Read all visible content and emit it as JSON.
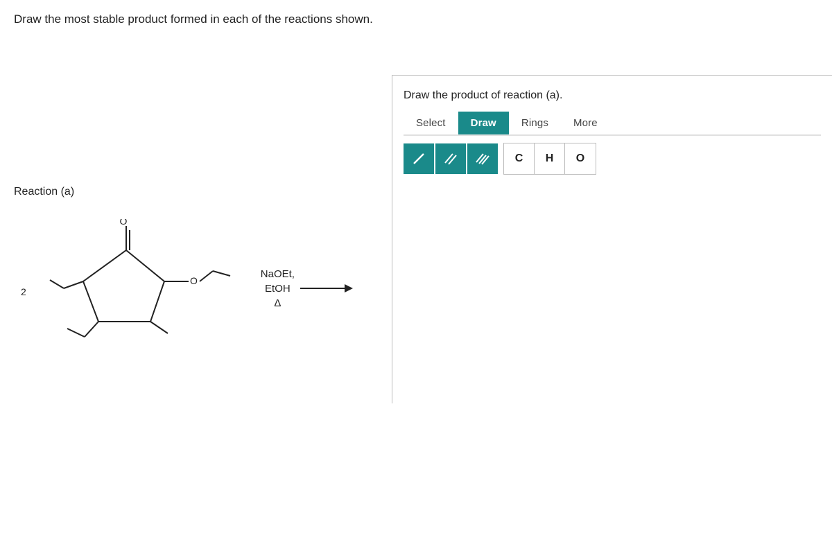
{
  "page": {
    "instruction": "Draw the most stable product formed in each of the reactions shown.",
    "panel_title": "Draw the product of reaction (a).",
    "toolbar": {
      "items": [
        {
          "label": "Select",
          "active": false
        },
        {
          "label": "Draw",
          "active": true
        },
        {
          "label": "Rings",
          "active": false
        },
        {
          "label": "More",
          "active": false
        }
      ]
    },
    "bond_tools": [
      {
        "label": "/",
        "title": "single-bond"
      },
      {
        "label": "//",
        "title": "double-bond"
      },
      {
        "label": "///",
        "title": "triple-bond"
      }
    ],
    "atom_tools": [
      {
        "label": "C"
      },
      {
        "label": "H"
      },
      {
        "label": "O"
      }
    ],
    "reaction": {
      "label": "Reaction (a)",
      "number": "2",
      "reagents": [
        "NaOEt,",
        "EtOH",
        "Δ"
      ]
    }
  }
}
